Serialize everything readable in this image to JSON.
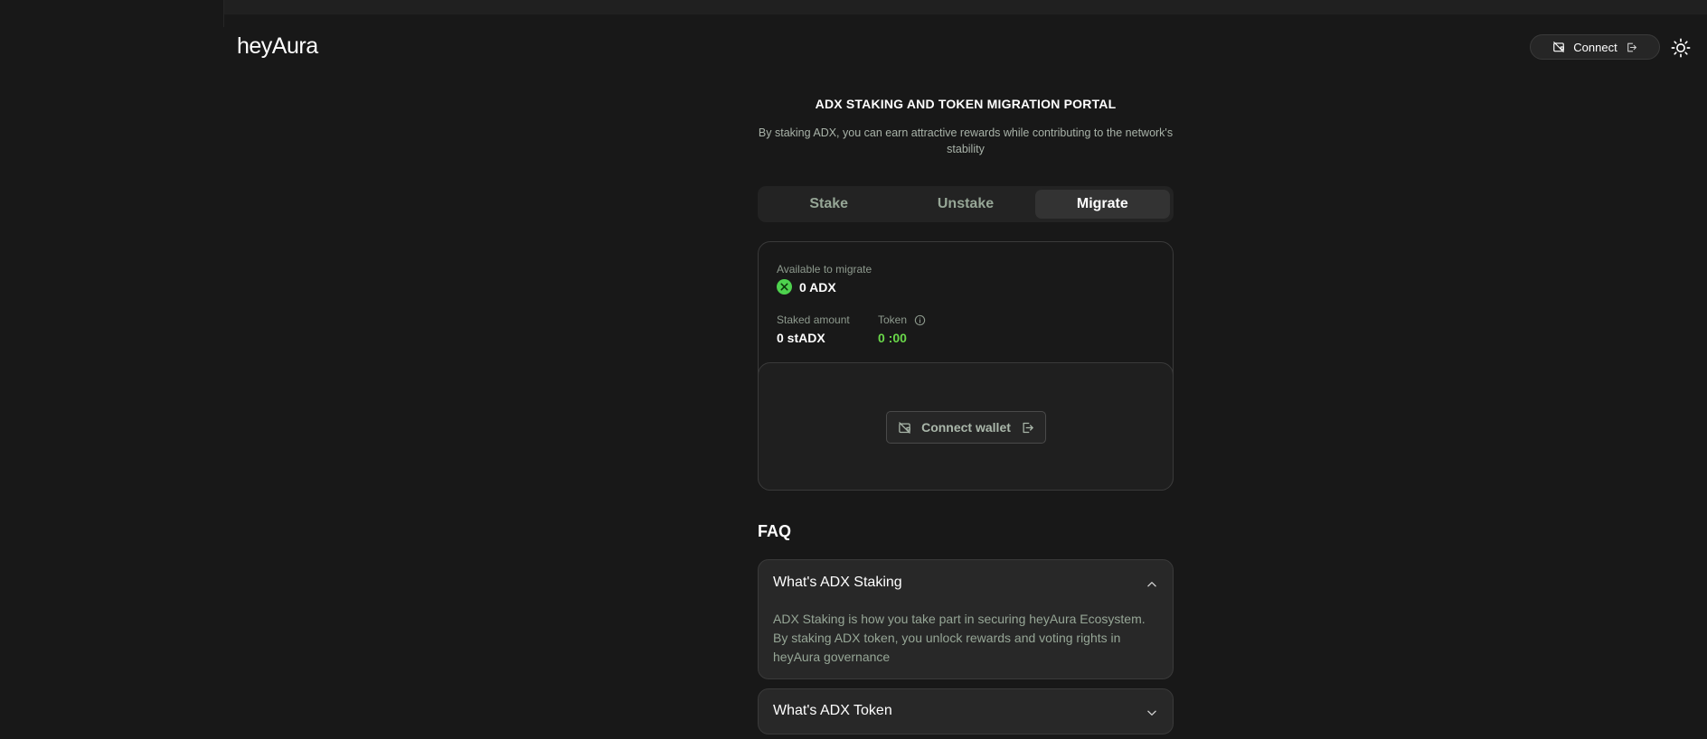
{
  "header": {
    "logo": "heyAura",
    "connect_label": "Connect",
    "icons": {
      "wallet": "wallet-off-icon",
      "login": "login-icon",
      "theme": "sun-icon"
    }
  },
  "hero": {
    "title": "ADX STAKING AND TOKEN MIGRATION PORTAL",
    "subtitle": "By staking ADX, you can earn attractive rewards while contributing to the network's stability"
  },
  "tabs": [
    {
      "label": "Stake",
      "active": false
    },
    {
      "label": "Unstake",
      "active": false
    },
    {
      "label": "Migrate",
      "active": true
    }
  ],
  "migrate": {
    "available_label": "Available to migrate",
    "available_value": "0 ADX",
    "staked_label": "Staked amount",
    "staked_value": "0 stADX",
    "token_label": "Token",
    "token_value": "0 :00",
    "connect_wallet_label": "Connect wallet"
  },
  "faq": {
    "title": "FAQ",
    "items": [
      {
        "question": "What's ADX Staking",
        "answer": "ADX Staking is how you take part in securing heyAura Ecosystem. By staking ADX token, you unlock rewards and voting rights in heyAura governance",
        "expanded": true
      },
      {
        "question": "What's ADX Token",
        "answer": "",
        "expanded": false
      }
    ]
  },
  "colors": {
    "background": "#181818",
    "card": "#191919",
    "accent_green": "#6ad84a",
    "muted_text": "#96a696",
    "border": "#3a3a3a"
  }
}
